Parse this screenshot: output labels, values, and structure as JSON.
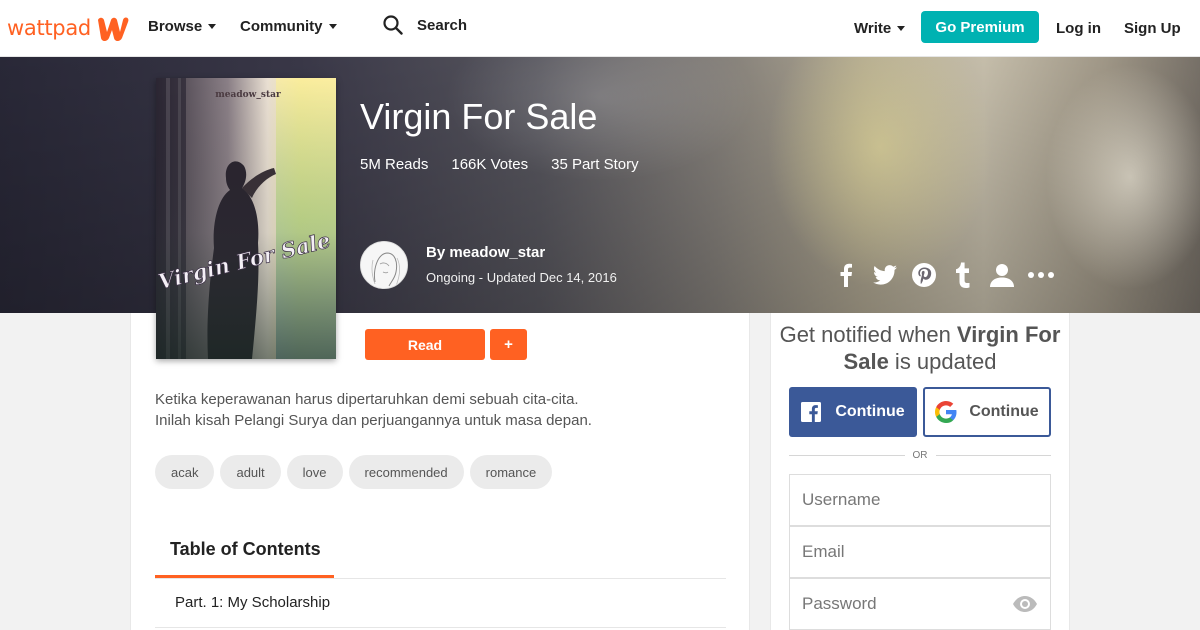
{
  "nav": {
    "logo": "wattpad",
    "browse": "Browse",
    "community": "Community",
    "search_placeholder": "Search",
    "write": "Write",
    "premium": "Go Premium",
    "login": "Log in",
    "signup": "Sign Up"
  },
  "story": {
    "title": "Virgin For Sale",
    "reads": "5M Reads",
    "votes": "166K Votes",
    "parts": "35 Part Story",
    "by": "By meadow_star",
    "status": "Ongoing - Updated Dec 14, 2016",
    "cover_author": "meadow_star",
    "cover_title": "Virgin For Sale",
    "description_line1": "Ketika keperawanan harus dipertaruhkan demi sebuah cita-cita.",
    "description_line2": "Inilah kisah Pelangi Surya dan perjuangannya untuk masa depan.",
    "tags": [
      "acak",
      "adult",
      "love",
      "recommended",
      "romance"
    ]
  },
  "actions": {
    "read": "Read",
    "add": "+"
  },
  "toc": {
    "tab": "Table of Contents",
    "parts": [
      "Part. 1: My Scholarship"
    ]
  },
  "signup_panel": {
    "notify_prefix": "Get notified when ",
    "notify_title": "Virgin For Sale",
    "notify_suffix": " is updated",
    "facebook": "Continue",
    "google": "Continue",
    "or": "OR",
    "username_placeholder": "Username",
    "email_placeholder": "Email",
    "password_placeholder": "Password"
  },
  "colors": {
    "brand": "#ff6122",
    "premium": "#00b2b2",
    "facebook": "#3b5998"
  },
  "icons": {
    "search": "search-icon",
    "share": [
      "facebook-icon",
      "twitter-icon",
      "pinterest-icon",
      "tumblr-icon",
      "user-icon",
      "more-icon"
    ],
    "eye": "eye-icon"
  }
}
